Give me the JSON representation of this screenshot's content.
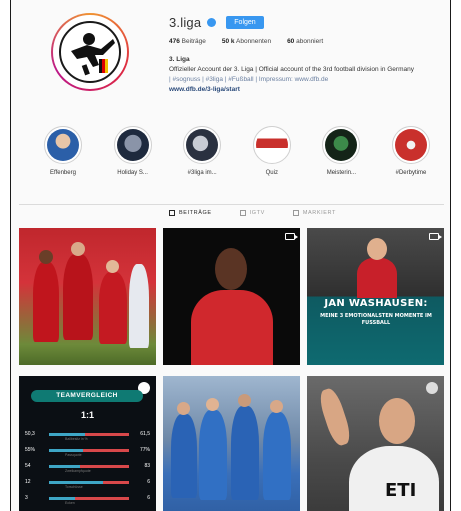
{
  "profile": {
    "username": "3.liga",
    "follow_label": "Folgen",
    "stats": {
      "posts": "476",
      "posts_label": "Beiträge",
      "followers": "50 k",
      "followers_label": "Abonnenten",
      "following": "60",
      "following_label": "abonniert"
    },
    "bio": {
      "name": "3. Liga",
      "line1": "Offizieller Account der 3. Liga | Official account of the 3rd football division in Germany",
      "line2": "| #sognuss | #3liga | #Fußball | Impressum: www.dfb.de",
      "link": "www.dfb.de/3-liga/start"
    }
  },
  "highlights": [
    {
      "label": "Effenberg"
    },
    {
      "label": "Holiday S..."
    },
    {
      "label": "#3liga im..."
    },
    {
      "label": "Quiz"
    },
    {
      "label": "Meisterin..."
    },
    {
      "label": "#Derbytime"
    }
  ],
  "tabs": [
    {
      "label": "BEITRÄGE"
    },
    {
      "label": "IGTV"
    },
    {
      "label": "MARKIERT"
    }
  ],
  "posts": {
    "p3": {
      "title": "JAN WASHAUSEN:",
      "subtitle": "MEINE 3 EMOTIONALSTEN MOMENTE IM FUSSBALL"
    },
    "p4": {
      "header": "TEAMVERGLEICH",
      "score": "1:1",
      "rows": [
        {
          "left": "50,3",
          "right": "61,5",
          "fill": 0.45,
          "label": "Ballbesitz in %"
        },
        {
          "left": "55%",
          "right": "77%",
          "fill": 0.42,
          "label": "Passquote"
        },
        {
          "left": "54",
          "right": "83",
          "fill": 0.39,
          "label": "Zweikampfquote"
        },
        {
          "left": "12",
          "right": "6",
          "fill": 0.67,
          "label": "Torschüsse"
        },
        {
          "left": "3",
          "right": "6",
          "fill": 0.33,
          "label": "Ecken"
        }
      ]
    },
    "p6": {
      "shirt_text": "ETI"
    }
  },
  "colors": {
    "accent_blue": "#3897f0",
    "teal": "#0f7a73"
  }
}
